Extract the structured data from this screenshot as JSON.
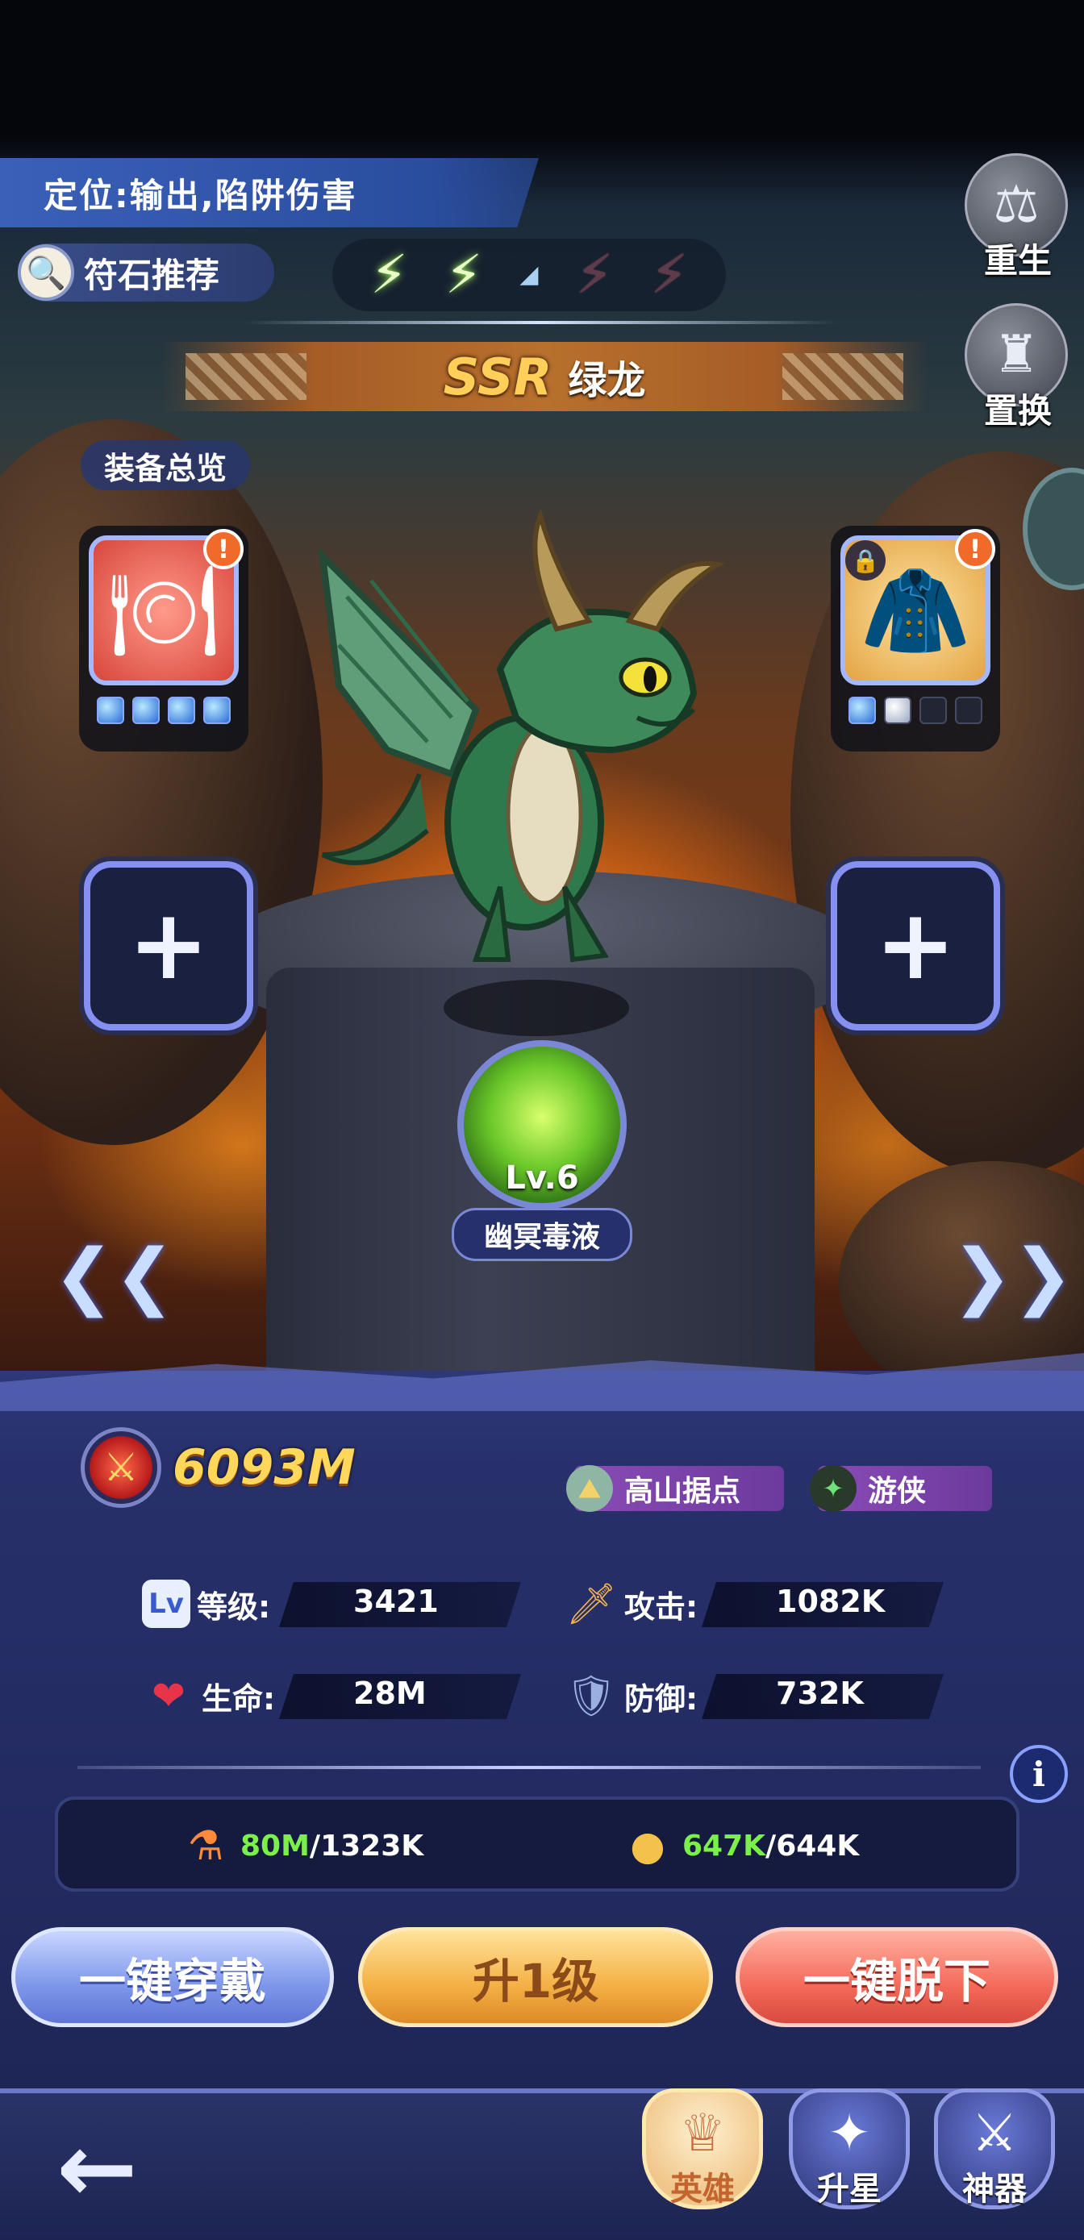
{
  "hero": {
    "role": "定位:输出,陷阱伤害",
    "rune_label": "符石推荐",
    "rarity": "SSR",
    "name": "绿龙",
    "power": "6093M",
    "faction": "高山据点",
    "class": "游侠"
  },
  "side_buttons": {
    "rebirth": "重生",
    "replace": "置换"
  },
  "equipment": {
    "overview_label": "装备总览"
  },
  "skill": {
    "level": "Lv.6",
    "name": "幽冥毒液"
  },
  "stats": {
    "level_label": "等级:",
    "level_value": "3421",
    "attack_label": "攻击:",
    "attack_value": "1082K",
    "hp_label": "生命:",
    "hp_value": "28M",
    "defense_label": "防御:",
    "defense_value": "732K"
  },
  "resources": {
    "potion_have": "80M",
    "potion_need": "/1323K",
    "coin_have": "647K",
    "coin_need": "/644K"
  },
  "actions": {
    "equip_all": "一键穿戴",
    "level_up": "升1级",
    "unequip_all": "一键脱下"
  },
  "nav": {
    "hero": "英雄",
    "star_up": "升星",
    "artifact": "神器"
  },
  "icons": {
    "info": "i"
  },
  "colors": {
    "accent_gold": "#ffd75a",
    "resource_green": "#7cf04a",
    "panel_blue": "#27306a"
  }
}
